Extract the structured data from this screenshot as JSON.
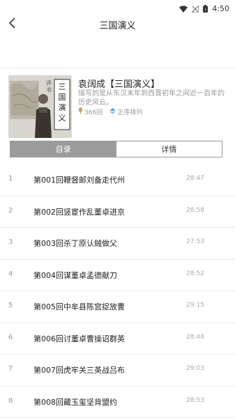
{
  "status_bar": {
    "time": "4:50",
    "icons": [
      "wifi-icon",
      "signal-icon",
      "battery-icon"
    ]
  },
  "nav": {
    "title": "三国演义",
    "back_icon": "chevron-left-icon"
  },
  "book": {
    "title": "袁阔成【三国演义】",
    "description": "描写的是从东汉末年到西晋初年之间近一百年的历史风云。",
    "episodes": "366回",
    "sort": "正序排列",
    "cover_text": "三国演义"
  },
  "tabs": [
    {
      "label": "目录",
      "active": true
    },
    {
      "label": "详情",
      "active": false
    }
  ],
  "episodes": [
    {
      "num": "1",
      "title": "第001回鞭督邮刘备走代州",
      "duration": "28:47"
    },
    {
      "num": "2",
      "title": "第002回竖宦作乱董卓进京",
      "duration": "28:58"
    },
    {
      "num": "3",
      "title": "第003回杀丁原认贼做父",
      "duration": "27:53"
    },
    {
      "num": "4",
      "title": "第004回谋董卓孟德献刀",
      "duration": "28:52"
    },
    {
      "num": "5",
      "title": "第005回中牟县陈宫捉放曹",
      "duration": "29:15"
    },
    {
      "num": "6",
      "title": "第006回讨董卓曹操诏群英",
      "duration": "28:48"
    },
    {
      "num": "7",
      "title": "第007回虎牢关三英战吕布",
      "duration": "29:03"
    },
    {
      "num": "8",
      "title": "第008回藏玉玺坚背盟约",
      "duration": "28:53"
    }
  ],
  "colors": {
    "active_tab": "#9b9b9b",
    "episode_icon": "#c8a46b",
    "sort_icon": "#5aa0e0"
  }
}
